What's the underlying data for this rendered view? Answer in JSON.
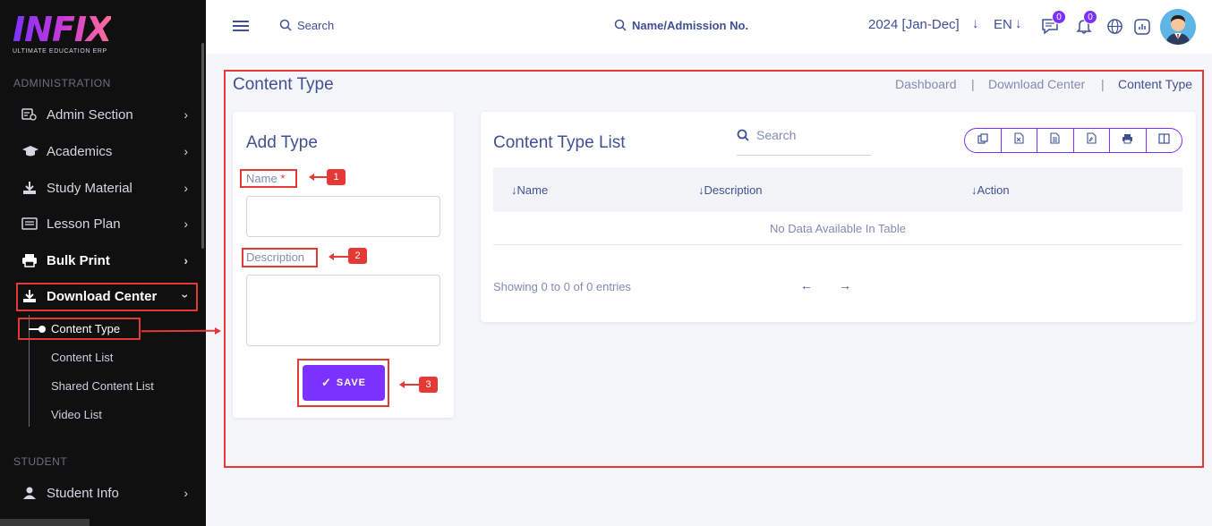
{
  "sidebar": {
    "logo_text": "INFIX",
    "logo_tagline": "ULTIMATE EDUCATION ERP",
    "section_admin": "ADMINISTRATION",
    "section_student": "STUDENT",
    "items": [
      {
        "label": "Admin Section",
        "icon": "admin-icon"
      },
      {
        "label": "Academics",
        "icon": "graduation-cap-icon"
      },
      {
        "label": "Study Material",
        "icon": "download-icon"
      },
      {
        "label": "Lesson Plan",
        "icon": "lesson-icon"
      },
      {
        "label": "Bulk Print",
        "icon": "print-icon"
      },
      {
        "label": "Download Center",
        "icon": "download-icon"
      }
    ],
    "sub_items": [
      "Content Type",
      "Content List",
      "Shared Content List",
      "Video List"
    ],
    "student_items": [
      {
        "label": "Student Info",
        "icon": "user-icon"
      }
    ]
  },
  "header": {
    "search_placeholder": "Search",
    "admission_search": "Name/Admission No.",
    "session": "2024 [Jan-Dec]",
    "language": "EN",
    "message_count": "0",
    "notification_count": "0"
  },
  "page": {
    "title": "Content Type",
    "breadcrumb": [
      "Dashboard",
      "Download Center",
      "Content Type"
    ]
  },
  "form": {
    "title": "Add Type",
    "name_label": "Name",
    "required_mark": "*",
    "description_label": "Description",
    "save_label": "SAVE"
  },
  "list": {
    "title": "Content Type List",
    "search_placeholder": "Search",
    "columns": [
      "Name",
      "Description",
      "Action"
    ],
    "empty_text": "No Data Available In Table",
    "showing_text": "Showing 0 to 0 of 0 entries"
  },
  "callouts": [
    "1",
    "2",
    "3"
  ],
  "colors": {
    "accent": "#7c32ff",
    "annotation": "#e53935",
    "sidebar": "#101010",
    "text": "#415094"
  }
}
